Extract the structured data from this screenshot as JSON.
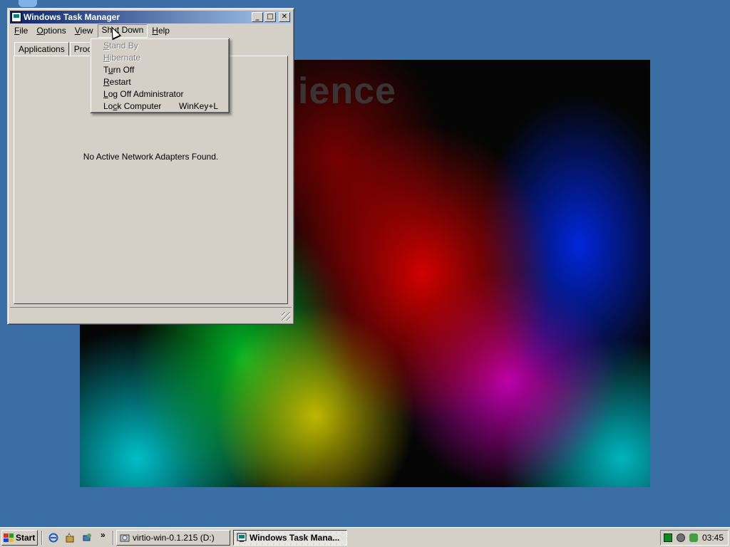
{
  "wallpaper": {
    "text": "ience"
  },
  "window": {
    "title": "Windows Task Manager",
    "title_icon": "task-manager-icon",
    "buttons": {
      "minimize": "_",
      "maximize": "□",
      "close": "✕"
    },
    "menu": [
      {
        "accel": "F",
        "rest": "ile"
      },
      {
        "accel": "O",
        "rest": "ptions"
      },
      {
        "accel": "V",
        "rest": "iew"
      },
      {
        "pre": "Shu",
        "accel": "t",
        "rest": " Down"
      },
      {
        "accel": "H",
        "rest": "elp"
      }
    ],
    "tabs": {
      "applications": "Applications",
      "processes": "Proces"
    },
    "panel_message": "No Active Network Adapters Found."
  },
  "shutdown_menu": {
    "items": [
      {
        "accel": "S",
        "rest": "tand By",
        "disabled": true
      },
      {
        "accel": "H",
        "rest": "ibernate",
        "disabled": true
      },
      {
        "pre": "T",
        "accel": "u",
        "rest": "rn Off",
        "disabled": false
      },
      {
        "accel": "R",
        "rest": "estart",
        "disabled": false
      },
      {
        "accel": "L",
        "rest": "og Off Administrator",
        "disabled": false
      },
      {
        "pre": "Lo",
        "accel": "c",
        "rest": "k Computer",
        "shortcut": "WinKey+L",
        "disabled": false
      }
    ]
  },
  "taskbar": {
    "start_label": "Start",
    "quick_launch_more": "»",
    "tasks": {
      "cd": "virtio-win-0.1.215 (D:)",
      "taskmgr": "Windows Task Mana..."
    },
    "clock": "03:45"
  },
  "colors": {
    "desktop": "#3a6ea5",
    "title_start": "#0a246a",
    "title_end": "#a6caf0",
    "face": "#d4d0c8"
  }
}
